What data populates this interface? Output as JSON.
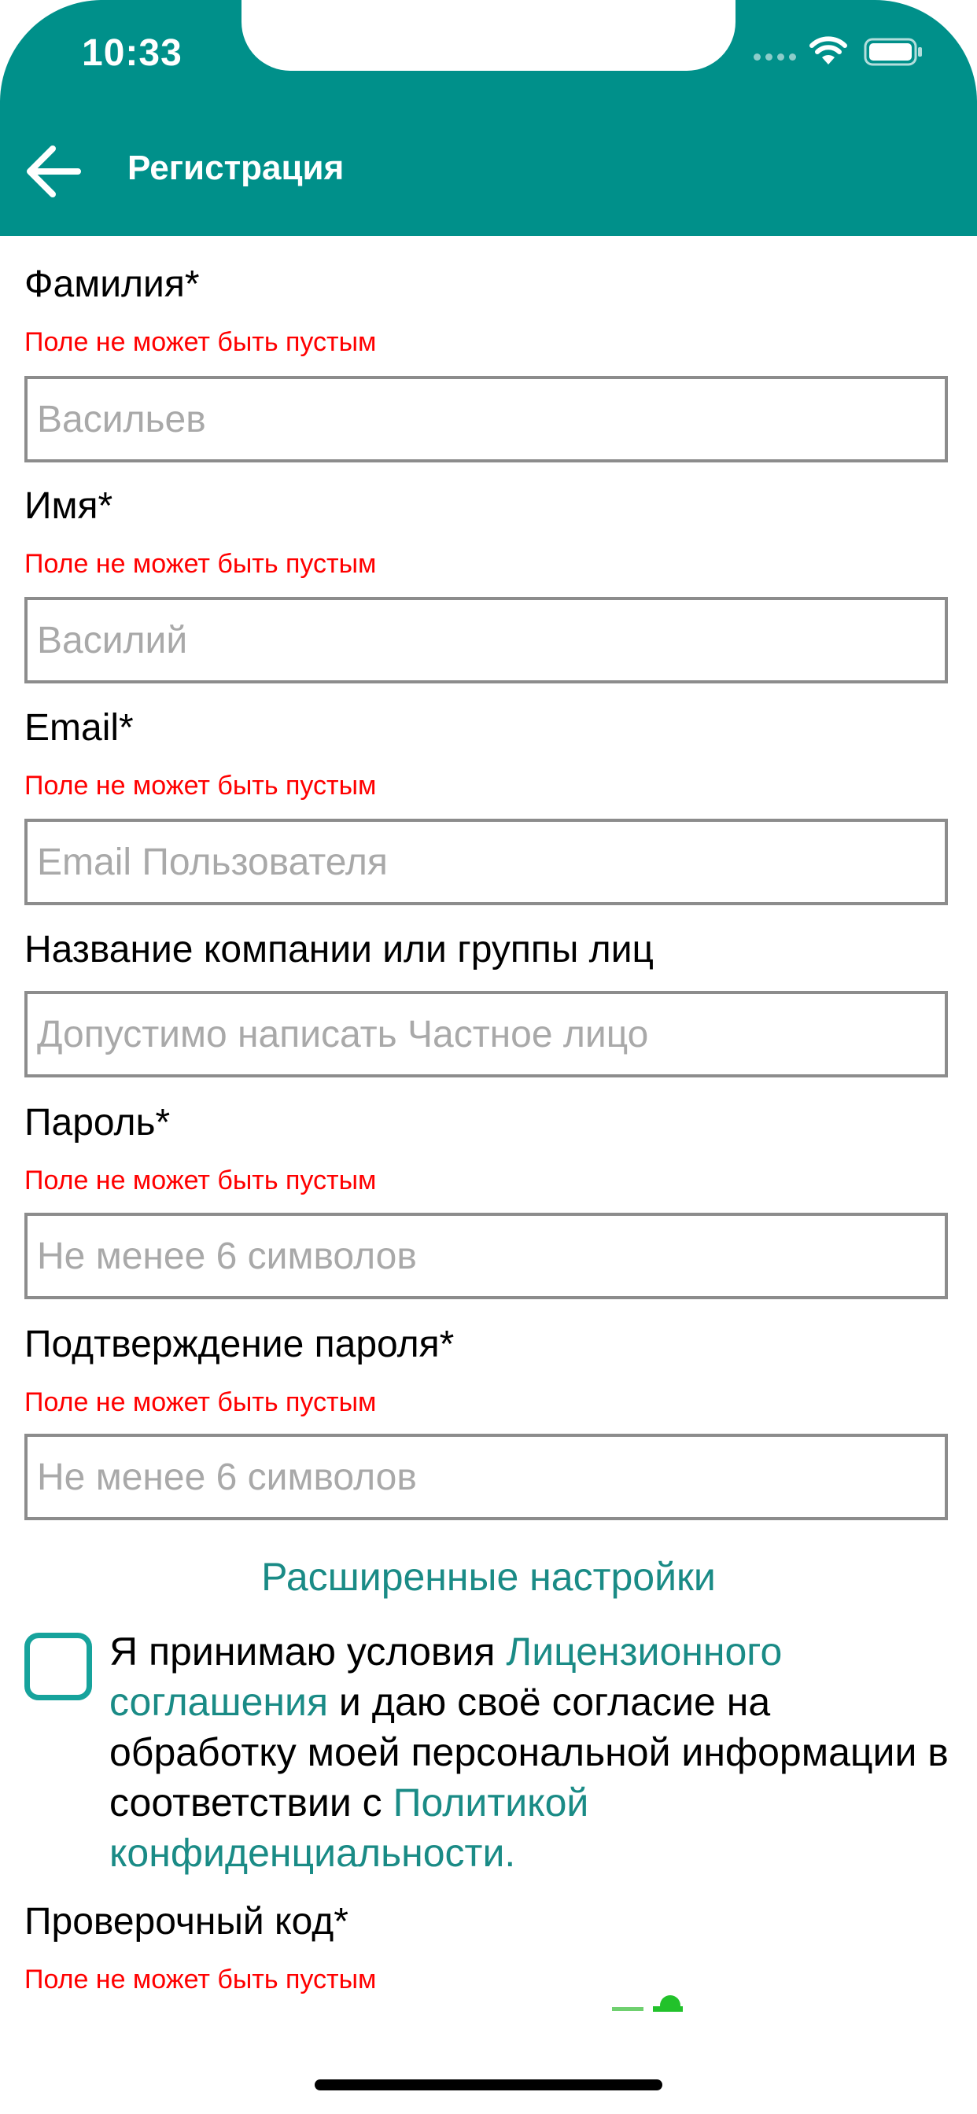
{
  "status_bar": {
    "time": "10:33"
  },
  "header": {
    "title": "Регистрация"
  },
  "form": {
    "error_text": "Поле не может быть пустым",
    "last_name": {
      "label": "Фамилия*",
      "placeholder": "Васильев"
    },
    "first_name": {
      "label": "Имя*",
      "placeholder": "Василий"
    },
    "email": {
      "label": "Email*",
      "placeholder": "Email Пользователя"
    },
    "company": {
      "label": "Название компании или группы лиц",
      "placeholder": "Допустимо написать Частное лицо"
    },
    "password": {
      "label": "Пароль*",
      "placeholder": "Не менее 6 символов"
    },
    "password_confirm": {
      "label": "Подтверждение пароля*",
      "placeholder": "Не менее 6 символов"
    },
    "advanced_settings": "Расширенные настройки",
    "consent": {
      "checked": false,
      "text_1": "Я принимаю условия ",
      "link_1": "Лицензионного соглашения",
      "text_2": " и даю своё согласие на обработку моей персональной информации в соответствии с ",
      "link_2": "Политикой конфиденциальности."
    },
    "captcha": {
      "label": "Проверочный код*"
    }
  },
  "colors": {
    "header": "#00908a",
    "link": "#1a8b86",
    "checkbox": "#16a39c",
    "error": "#ff0000",
    "field_border": "#8c8c8c"
  },
  "icons": [
    "back-arrow-icon",
    "wifi-icon",
    "battery-icon",
    "cellular-signal-icon"
  ]
}
